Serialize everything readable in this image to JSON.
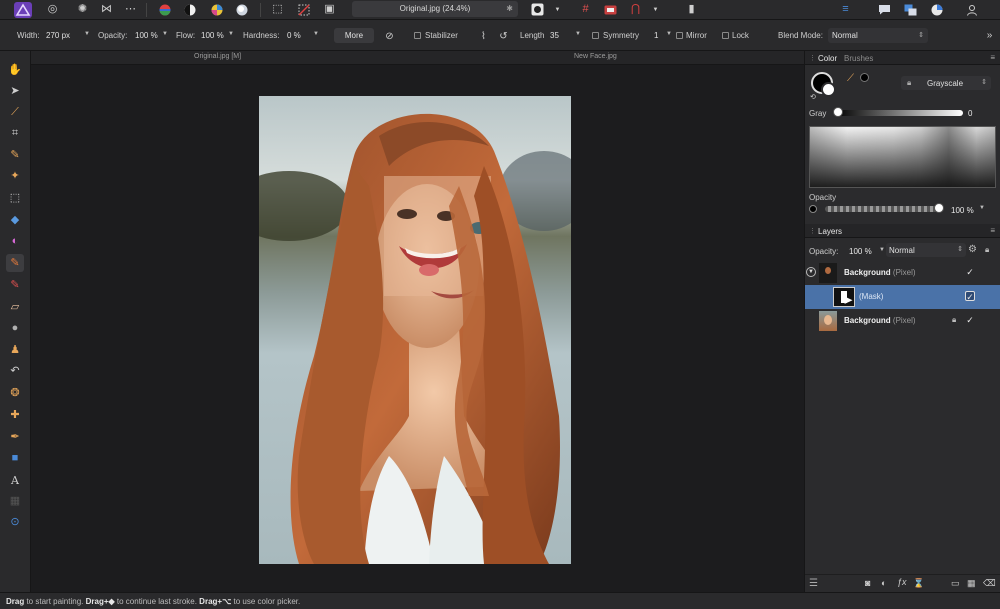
{
  "app": {
    "document_title": "Original.jpg (24.4%)",
    "document_star": "✱"
  },
  "context_bar": {
    "width_label": "Width:",
    "width_value": "270 px",
    "opacity_label": "Opacity:",
    "opacity_value": "100 %",
    "flow_label": "Flow:",
    "flow_value": "100 %",
    "hardness_label": "Hardness:",
    "hardness_value": "0 %",
    "more_label": "More",
    "stabilizer_label": "Stabilizer",
    "length_label": "Length",
    "length_value": "35",
    "symmetry_label": "Symmetry",
    "symmetry_value": "1",
    "mirror_label": "Mirror",
    "lock_label": "Lock",
    "blend_mode_label": "Blend Mode:",
    "blend_mode_value": "Normal"
  },
  "document_tabs": [
    "Original.jpg [M]",
    "New Face.jpg"
  ],
  "color_panel": {
    "tabs": [
      "Color",
      "Brushes"
    ],
    "model": "Grayscale",
    "gray_label": "Gray",
    "gray_value": "0",
    "opacity_label": "Opacity",
    "opacity_value": "100 %"
  },
  "layers_panel": {
    "title": "Layers",
    "opacity_label": "Opacity:",
    "opacity_value": "100 %",
    "blend_value": "Normal",
    "layers": [
      {
        "name": "Background",
        "type": "(Pixel)",
        "checked": "✓"
      },
      {
        "name": "(Mask)",
        "type": "",
        "checked": "✓"
      },
      {
        "name": "Background",
        "type": "(Pixel)",
        "checked": "✓"
      }
    ]
  },
  "status_bar": {
    "drag1": "Drag",
    "text1": " to start painting. ",
    "drag2": "Drag+◆",
    "text2": " to continue last stroke. ",
    "drag3": "Drag+⌥",
    "text3": " to use color picker."
  },
  "colors": {
    "accent": "#4a72a8",
    "panel_bg": "#2b2b2d",
    "canvas_bg": "#1c1c1e"
  }
}
